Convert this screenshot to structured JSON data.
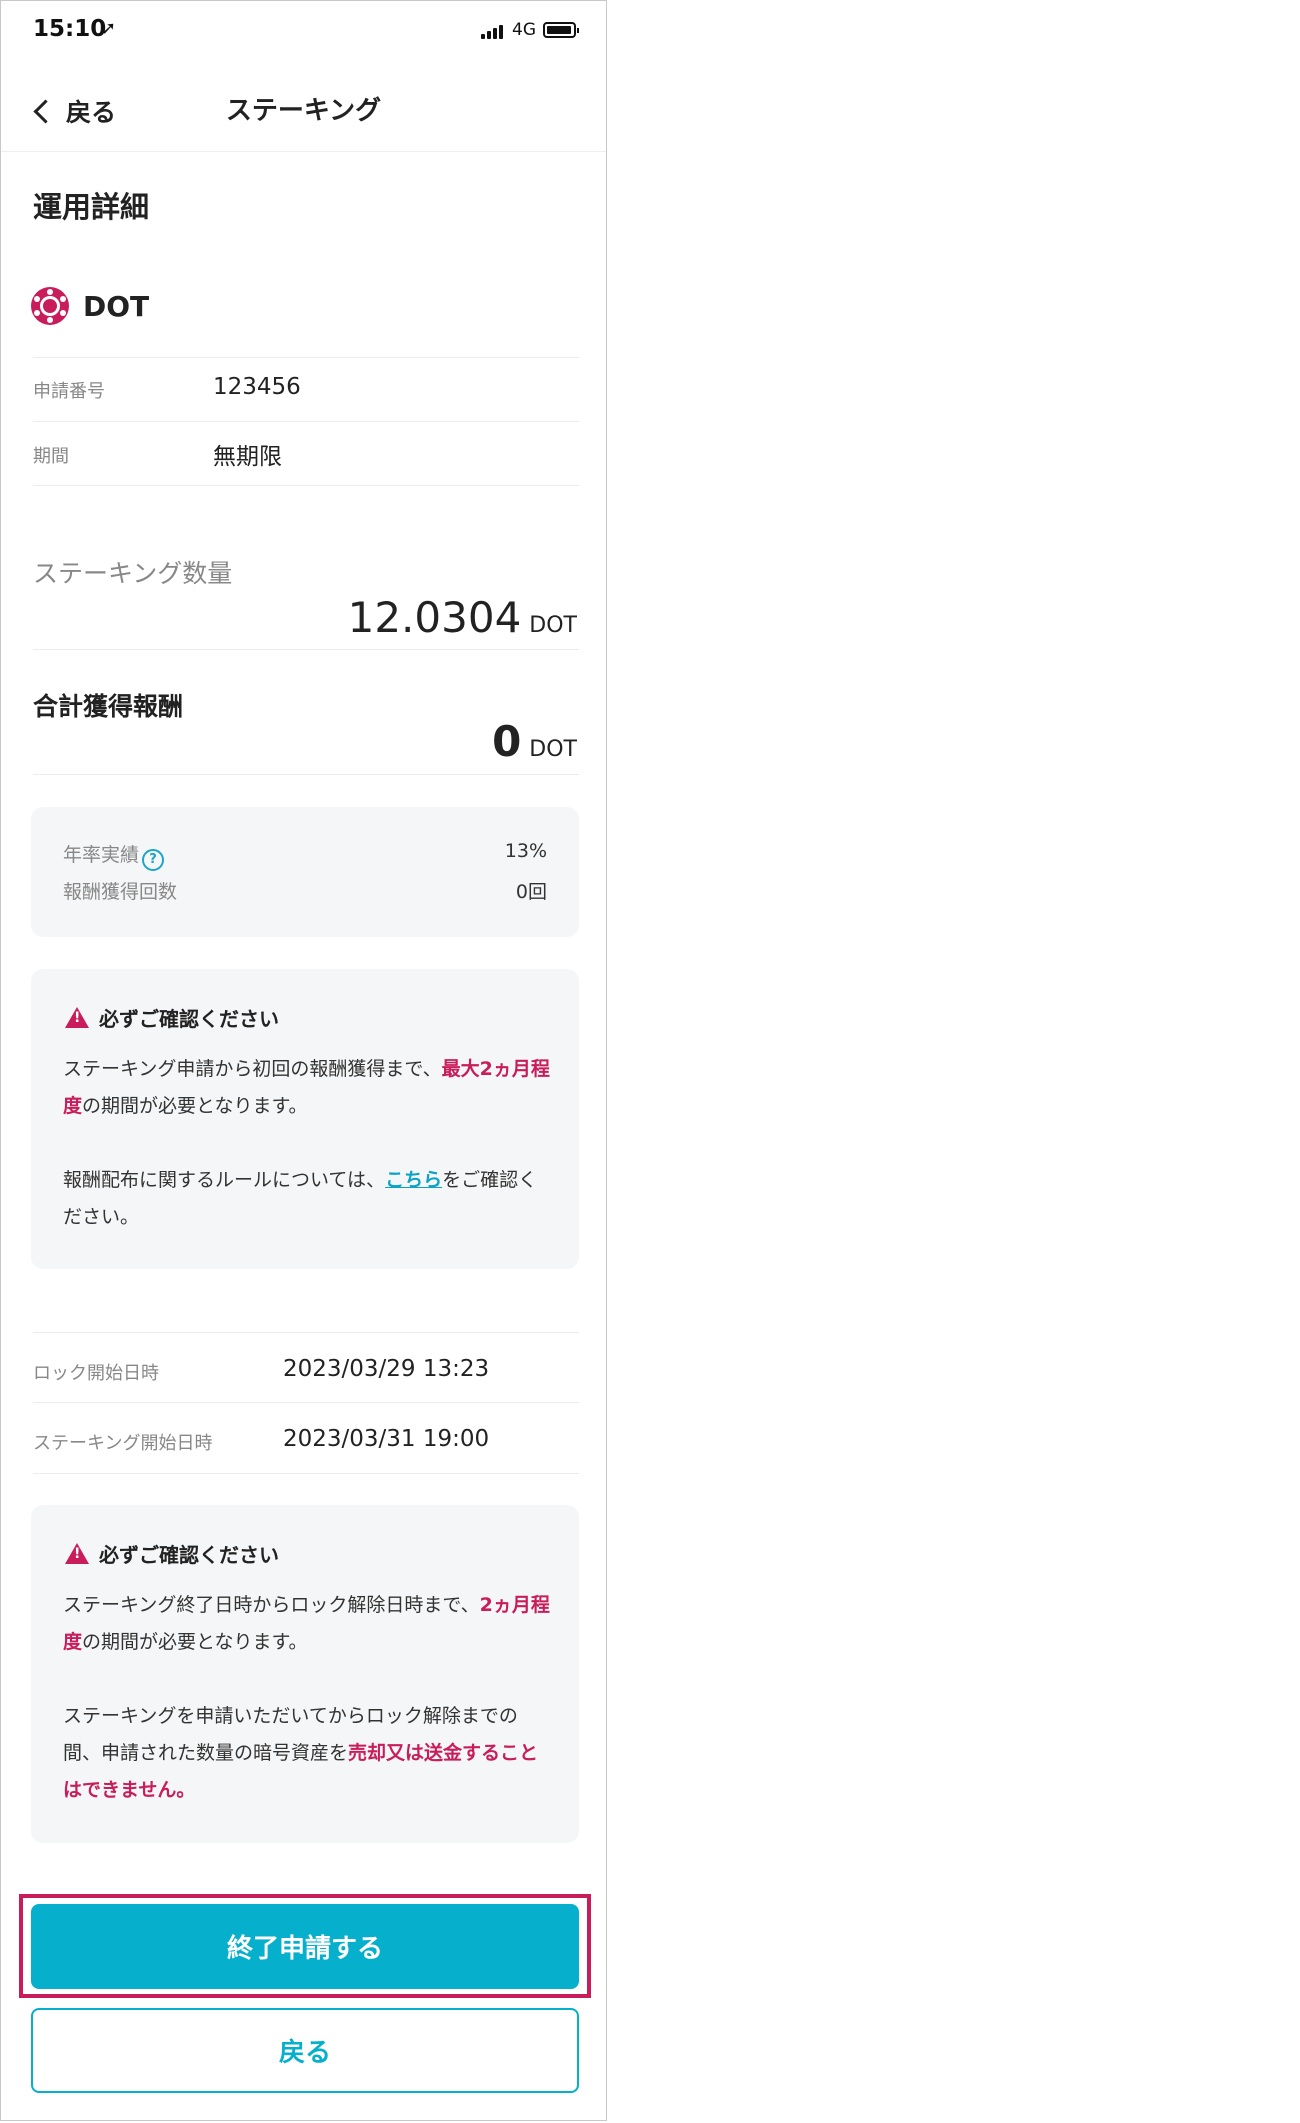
{
  "status_bar": {
    "time": "15:10",
    "network": "4G"
  },
  "nav": {
    "back_label": "戻る",
    "title": "ステーキング"
  },
  "section_title": "運用詳細",
  "coin": {
    "name": "DOT"
  },
  "details": [
    {
      "label": "申請番号",
      "value": "123456"
    },
    {
      "label": "期間",
      "value": "無期限"
    }
  ],
  "staking_amount": {
    "label": "ステーキング数量",
    "value": "12.0304",
    "unit": "DOT"
  },
  "total_reward": {
    "label": "合計獲得報酬",
    "value": "0",
    "unit": "DOT"
  },
  "stats": [
    {
      "label": "年率実績",
      "value": "13%"
    },
    {
      "label": "報酬獲得回数",
      "value": "0回"
    }
  ],
  "notice1": {
    "title": "必ずご確認ください",
    "p1_a": "ステーキング申請から初回の報酬獲得まで、",
    "p1_em": "最大2ヵ月程度",
    "p1_b": "の期間が必要となります。",
    "p2_a": "報酬配布に関するルールについては、",
    "p2_link": "こちら",
    "p2_b": "をご確認ください。"
  },
  "dates": [
    {
      "label": "ロック開始日時",
      "value": "2023/03/29 13:23"
    },
    {
      "label": "ステーキング開始日時",
      "value": "2023/03/31 19:00"
    }
  ],
  "notice2": {
    "title": "必ずご確認ください",
    "p1_a": "ステーキング終了日時からロック解除日時まで、",
    "p1_em": "2ヵ月程度",
    "p1_b": "の期間が必要となります。",
    "p2_a": "ステーキングを申請いただいてからロック解除までの間、申請された数量の暗号資産を",
    "p2_em": "売却又は送金することはできません。"
  },
  "buttons": {
    "primary": "終了申請する",
    "secondary": "戻る"
  },
  "colors": {
    "accent": "#06afcc",
    "warning": "#c81d5a",
    "highlight_frame": "#c81d5a"
  }
}
